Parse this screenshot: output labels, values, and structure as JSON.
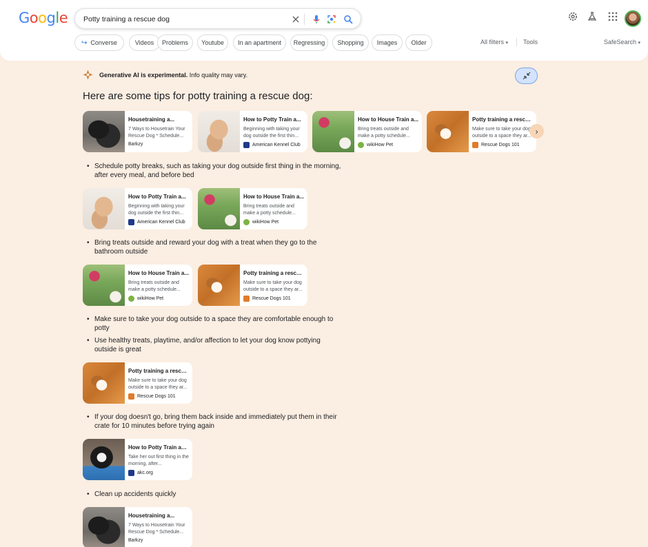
{
  "header": {
    "logo": [
      "G",
      "o",
      "o",
      "g",
      "l",
      "e"
    ],
    "search_value": "Potty training a rescue dog",
    "chips": [
      {
        "label": "Converse",
        "has_arrow": true
      },
      {
        "label": "Videos"
      },
      {
        "label": "Problems"
      },
      {
        "label": "Youtube"
      },
      {
        "label": "In an apartment"
      },
      {
        "label": "Regressing"
      },
      {
        "label": "Shopping"
      },
      {
        "label": "Images"
      },
      {
        "label": "Older"
      }
    ],
    "all_filters": "All filters",
    "tools": "Tools",
    "safesearch": "SafeSearch"
  },
  "ai": {
    "note_bold": "Generative AI is experimental.",
    "note_rest": " Info quality may vary.",
    "heading": "Here are some tips for potty training a rescue dog:"
  },
  "cards": [
    {
      "title": "Housetraining a...",
      "snippet": "7 Ways to Housetrain Your Rescue Dog * Schedule...",
      "source": "Barkzy",
      "fav": "none",
      "thumb": "t-black"
    },
    {
      "title": "How to Potty Train a...",
      "snippet": "Beginning with taking your dog outside the first thin...",
      "source": "American Kennel Club",
      "fav": "akc",
      "thumb": "t-poodle"
    },
    {
      "title": "How to House Train a...",
      "snippet": "Bring treats outside and make a potty schedule...",
      "source": "wikiHow Pet",
      "fav": "wiki",
      "thumb": "t-walk"
    },
    {
      "title": "Potty training a rescu...",
      "snippet": "Make sure to take your dog outside to a space they ar...",
      "source": "Rescue Dogs 101",
      "fav": "rd",
      "thumb": "t-beagle"
    },
    {
      "title": "How to Potty Train a...",
      "snippet": "Beginning with taking your dog outside the first thin...",
      "source": "American Kennel Club",
      "fav": "akc",
      "thumb": "t-poodle"
    },
    {
      "title": "How to House Train a...",
      "snippet": "Bring treats outside and make a potty schedule...",
      "source": "wikiHow Pet",
      "fav": "wiki",
      "thumb": "t-walk"
    },
    {
      "title": "How to House Train a...",
      "snippet": "Bring treats outside and make a potty schedule...",
      "source": "wikiHow Pet",
      "fav": "wiki",
      "thumb": "t-walk"
    },
    {
      "title": "Potty training a rescu...",
      "snippet": "Make sure to take your dog outside to a space they ar...",
      "source": "Rescue Dogs 101",
      "fav": "rd",
      "thumb": "t-beagle"
    },
    {
      "title": "Potty training a rescu...",
      "snippet": "Make sure to take your dog outside to a space they ar...",
      "source": "Rescue Dogs 101",
      "fav": "rd",
      "thumb": "t-beagle"
    },
    {
      "title": "How to Potty Train an...",
      "snippet": "Take her out first thing in the morning, after...",
      "source": "akc.org",
      "fav": "akc",
      "thumb": "t-collie"
    },
    {
      "title": "Housetraining a...",
      "snippet": "7 Ways to Housetrain Your Rescue Dog * Schedule...",
      "source": "Barkzy",
      "fav": "none",
      "thumb": "t-black"
    }
  ],
  "bullets": [
    "Schedule potty breaks, such as taking your dog outside first thing in the morning, after every meal, and before bed",
    "Bring treats outside and reward your dog with a treat when they go to the bathroom outside",
    "Make sure to take your dog outside to a space they are comfortable enough to potty",
    "Use healthy treats, playtime, and/or affection to let your dog know pottying outside is great",
    "If your dog doesn't go, bring them back inside and immediately put them in their crate for 10 minutes before trying again",
    "Clean up accidents quickly"
  ],
  "bullet_char": "•",
  "next_glyph": "›"
}
